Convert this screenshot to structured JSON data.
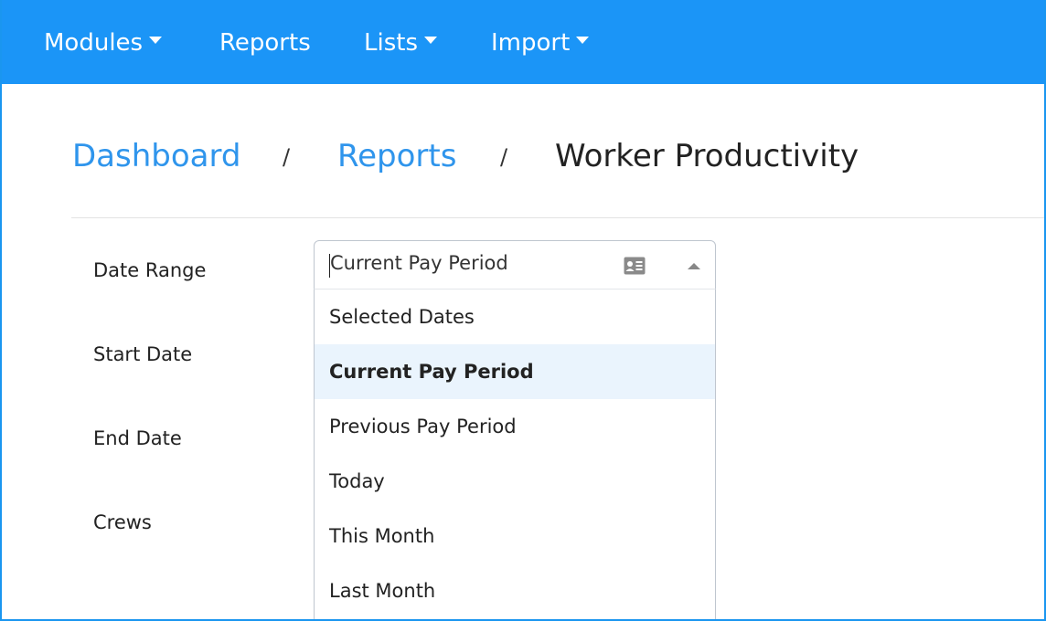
{
  "nav": {
    "items": [
      {
        "label": "Modules",
        "has_dropdown": true
      },
      {
        "label": "Reports",
        "has_dropdown": false
      },
      {
        "label": "Lists",
        "has_dropdown": true
      },
      {
        "label": "Import",
        "has_dropdown": true
      }
    ],
    "background_color": "#1b95f7"
  },
  "breadcrumb": {
    "items": [
      {
        "label": "Dashboard",
        "link": true
      },
      {
        "label": "Reports",
        "link": true
      },
      {
        "label": "Worker Productivity",
        "link": false
      }
    ],
    "separator": "/",
    "link_color": "#2f95ec"
  },
  "form": {
    "labels": {
      "date_range": "Date Range",
      "start_date": "Start Date",
      "end_date": "End Date",
      "crews": "Crews"
    },
    "date_range_select": {
      "value": "Current Pay Period",
      "icon": "id-card-icon",
      "open": true,
      "options": [
        {
          "label": "Selected Dates",
          "selected": false
        },
        {
          "label": "Current Pay Period",
          "selected": true
        },
        {
          "label": "Previous Pay Period",
          "selected": false
        },
        {
          "label": "Today",
          "selected": false
        },
        {
          "label": "This Month",
          "selected": false
        },
        {
          "label": "Last Month",
          "selected": false
        }
      ],
      "highlight_color": "#eaf4fd"
    }
  }
}
